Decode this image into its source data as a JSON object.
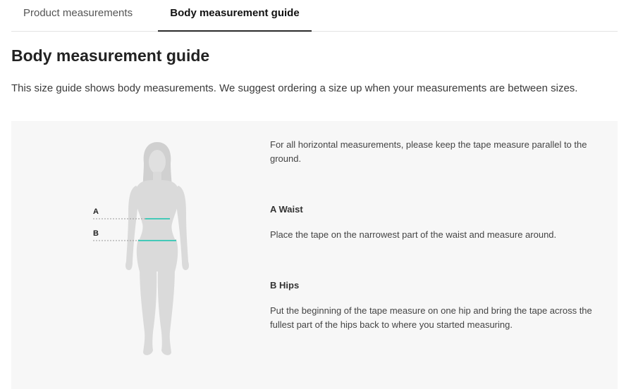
{
  "tabs": [
    {
      "label": "Product measurements",
      "active": false
    },
    {
      "label": "Body measurement guide",
      "active": true
    }
  ],
  "heading": "Body measurement guide",
  "intro": "This size guide shows body measurements. We suggest ordering a size up when your measurements are between sizes.",
  "figure": {
    "markers": [
      {
        "letter": "A",
        "name": "Waist"
      },
      {
        "letter": "B",
        "name": "Hips"
      }
    ],
    "body_color": "#dadada",
    "measure_line_color": "#45c9b8"
  },
  "instructions": {
    "note": "For all horizontal measurements, please keep the tape measure parallel to the ground.",
    "waist": {
      "heading": "A Waist",
      "description": "Place the tape on the narrowest part of the waist and measure around."
    },
    "hips": {
      "heading": "B Hips",
      "description": "Put the beginning of the tape measure on one hip and bring the tape across the fullest part of the hips back to where you started measuring."
    }
  }
}
